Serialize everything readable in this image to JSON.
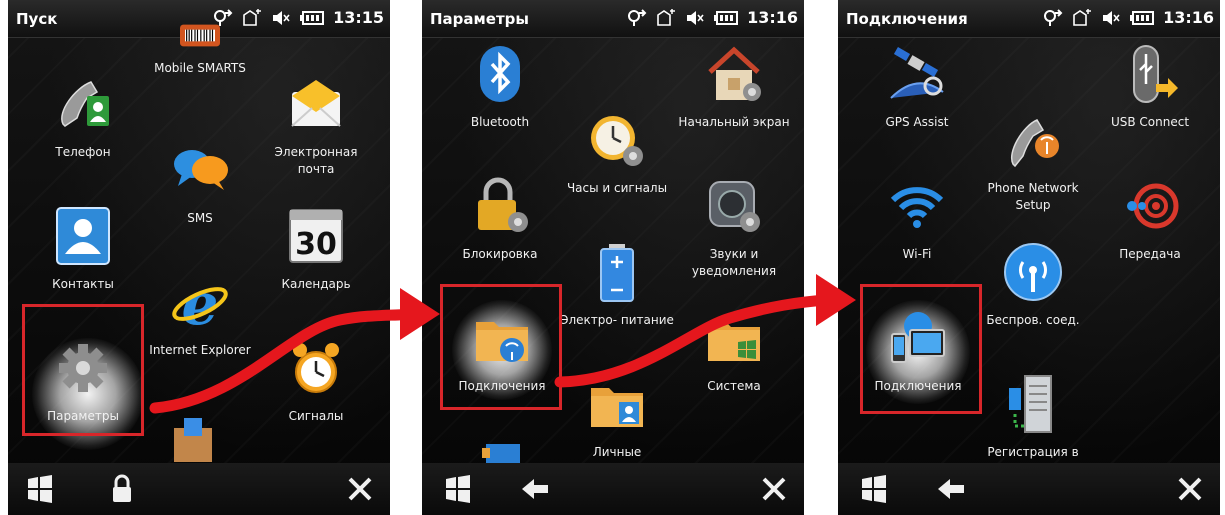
{
  "phones": [
    {
      "title": "Пуск",
      "time": "13:15",
      "tiles": [
        {
          "name": "mobile-smarts",
          "label": "Mobile SMARTS",
          "icon": "mobile-smarts-icon"
        },
        {
          "name": "phone",
          "label": "Телефон",
          "icon": "phone-icon"
        },
        {
          "name": "email",
          "label": "Электронная почта",
          "icon": "envelope-icon"
        },
        {
          "name": "sms",
          "label": "SMS",
          "icon": "chat-bubbles-icon"
        },
        {
          "name": "contacts",
          "label": "Контакты",
          "icon": "contact-card-icon"
        },
        {
          "name": "calendar",
          "label": "Календарь",
          "icon": "calendar-icon",
          "day": "30"
        },
        {
          "name": "internet-explorer",
          "label": "Internet Explorer",
          "icon": "internet-explorer-icon"
        },
        {
          "name": "settings",
          "label": "Параметры",
          "icon": "gear-icon"
        },
        {
          "name": "alarms",
          "label": "Сигналы",
          "icon": "alarm-clock-icon"
        }
      ],
      "bottom": [
        "windows-logo-icon",
        "lock-icon",
        "close-icon"
      ]
    },
    {
      "title": "Параметры",
      "time": "13:16",
      "tiles": [
        {
          "name": "bluetooth",
          "label": "Bluetooth",
          "icon": "bluetooth-icon"
        },
        {
          "name": "home-screen",
          "label": "Начальный экран",
          "icon": "house-gear-icon"
        },
        {
          "name": "clock-alarms",
          "label": "Часы и сигналы",
          "icon": "clock-gear-icon"
        },
        {
          "name": "lock",
          "label": "Блокировка",
          "icon": "padlock-gear-icon"
        },
        {
          "name": "sounds",
          "label": "Звуки и уведомления",
          "icon": "speaker-gear-icon"
        },
        {
          "name": "power",
          "label": "Электро- питание",
          "icon": "battery-icon"
        },
        {
          "name": "connections",
          "label": "Подключения",
          "icon": "folder-wireless-icon"
        },
        {
          "name": "system",
          "label": "Система",
          "icon": "folder-windows-icon"
        },
        {
          "name": "personal",
          "label": "Личные",
          "icon": "folder-contact-icon"
        }
      ],
      "bottom": [
        "windows-logo-icon",
        "back-arrow-icon",
        "close-icon"
      ]
    },
    {
      "title": "Подключения",
      "time": "13:16",
      "tiles": [
        {
          "name": "gps-assist",
          "label": "GPS Assist",
          "icon": "satellite-icon"
        },
        {
          "name": "usb-connect",
          "label": "USB Connect",
          "icon": "usb-icon"
        },
        {
          "name": "phone-network-setup",
          "label": "Phone Network Setup",
          "icon": "phone-antenna-icon"
        },
        {
          "name": "wifi",
          "label": "Wi-Fi",
          "icon": "wifi-icon"
        },
        {
          "name": "transfer",
          "label": "Передача",
          "icon": "beam-icon"
        },
        {
          "name": "wireless-connections",
          "label": "Беспров. соед.",
          "icon": "wireless-signal-icon"
        },
        {
          "name": "connections",
          "label": "Подключения",
          "icon": "computer-globe-icon"
        },
        {
          "name": "registration",
          "label": "Регистрация в",
          "icon": "server-icon"
        }
      ],
      "bottom": [
        "windows-logo-icon",
        "back-arrow-icon",
        "close-icon"
      ]
    }
  ],
  "colors": {
    "highlight": "#d8262a",
    "arrow": "#e5171d"
  }
}
